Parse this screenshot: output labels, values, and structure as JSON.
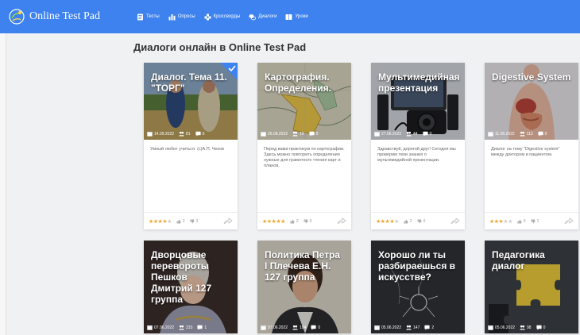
{
  "app": {
    "brand": "Online Test Pad"
  },
  "nav": [
    {
      "label": "Тесты",
      "icon": "test-icon"
    },
    {
      "label": "Опросы",
      "icon": "poll-icon"
    },
    {
      "label": "Кроссворды",
      "icon": "crossword-icon"
    },
    {
      "label": "Диалоги",
      "icon": "dialog-icon"
    },
    {
      "label": "Уроки",
      "icon": "lesson-icon"
    }
  ],
  "page": {
    "heading": "Диалоги онлайн в Online Test Pad"
  },
  "cards": [
    {
      "title": "Диалог. Тема 11. \"ТОРГ\"",
      "date": "14.09.2022",
      "users": "81",
      "questions": "0",
      "desc": "Умный любит учиться. (с)А.П. Чехов",
      "rating": 4,
      "likes": "2",
      "dislikes": "3",
      "checked": true
    },
    {
      "title": "Картография. Определения.",
      "date": "26.08.2022",
      "users": "10",
      "questions": "0",
      "desc": "Перед вами практикум по картографии. Здесь можно повторить определения нужные для грамотного чтения карт и планов.",
      "rating": 5,
      "likes": "2",
      "dislikes": "0",
      "checked": false
    },
    {
      "title": "Мультимедийная презентация",
      "date": "27.06.2022",
      "users": "44",
      "questions": "0",
      "desc": "Здравствуй, дорогой друг! Сегодня мы проверим твои знания о мультимедийной презентации.",
      "rating": 4,
      "likes": "2",
      "dislikes": "0",
      "checked": false
    },
    {
      "title": "Digestive System",
      "date": "11.06.2022",
      "users": "113",
      "questions": "0",
      "desc": "Диалог на тему \"Digestive system\" между доктором и пациентом.",
      "rating": 3,
      "likes": "5",
      "dislikes": "1",
      "checked": false
    },
    {
      "title": "Дворцовые перевороты Пешков Дмитрий 127 группа",
      "date": "07.06.2022",
      "users": "233",
      "questions": "1"
    },
    {
      "title": "Политика Петра I Плечева Е.Н. 127 группа",
      "date": "07.06.2022",
      "users": "104",
      "questions": "0"
    },
    {
      "title": "Хорошо ли ты разбираешься в искусстве?",
      "date": "05.06.2022",
      "users": "147",
      "questions": "2"
    },
    {
      "title": "Педагогика диалог",
      "date": "05.06.2022",
      "users": "98",
      "questions": "0"
    }
  ],
  "colors": {
    "accent": "#3d82ee",
    "star": "#f0a530",
    "background": "#f0f1f3"
  }
}
